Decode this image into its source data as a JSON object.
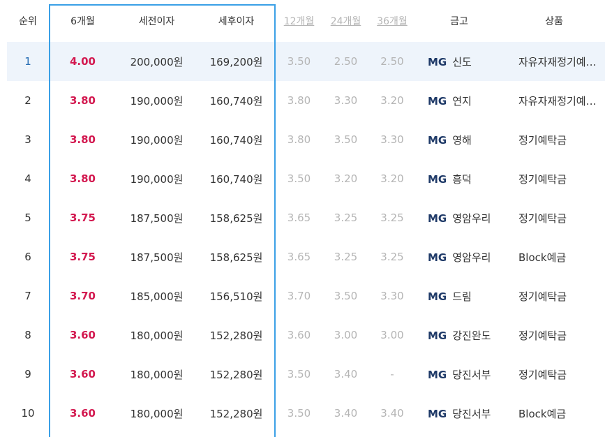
{
  "headers": {
    "rank": "순위",
    "m6": "6개월",
    "pretax": "세전이자",
    "aftertax": "세후이자",
    "m12": "12개월",
    "m24": "24개월",
    "m36": "36개월",
    "bank": "금고",
    "product": "상품"
  },
  "colors": {
    "highlight_border": "#3aa0e6",
    "rate6": "#d31950",
    "muted": "#b5b5b5",
    "first_row_bg": "#eef4fb",
    "mg": "#1f3a68"
  },
  "rows": [
    {
      "rank": "1",
      "m6": "4.00",
      "pretax": "200,000원",
      "aftertax": "169,200원",
      "m12": "3.50",
      "m24": "2.50",
      "m36": "2.50",
      "mg": "MG",
      "bank": "신도",
      "product": "자유자재정기예…"
    },
    {
      "rank": "2",
      "m6": "3.80",
      "pretax": "190,000원",
      "aftertax": "160,740원",
      "m12": "3.80",
      "m24": "3.30",
      "m36": "3.20",
      "mg": "MG",
      "bank": "연지",
      "product": "자유자재정기예…"
    },
    {
      "rank": "3",
      "m6": "3.80",
      "pretax": "190,000원",
      "aftertax": "160,740원",
      "m12": "3.80",
      "m24": "3.50",
      "m36": "3.30",
      "mg": "MG",
      "bank": "영해",
      "product": "정기예탁금"
    },
    {
      "rank": "4",
      "m6": "3.80",
      "pretax": "190,000원",
      "aftertax": "160,740원",
      "m12": "3.50",
      "m24": "3.20",
      "m36": "3.20",
      "mg": "MG",
      "bank": "흥덕",
      "product": "정기예탁금"
    },
    {
      "rank": "5",
      "m6": "3.75",
      "pretax": "187,500원",
      "aftertax": "158,625원",
      "m12": "3.65",
      "m24": "3.25",
      "m36": "3.25",
      "mg": "MG",
      "bank": "영암우리",
      "product": "정기예탁금"
    },
    {
      "rank": "6",
      "m6": "3.75",
      "pretax": "187,500원",
      "aftertax": "158,625원",
      "m12": "3.65",
      "m24": "3.25",
      "m36": "3.25",
      "mg": "MG",
      "bank": "영암우리",
      "product": "Block예금"
    },
    {
      "rank": "7",
      "m6": "3.70",
      "pretax": "185,000원",
      "aftertax": "156,510원",
      "m12": "3.70",
      "m24": "3.50",
      "m36": "3.30",
      "mg": "MG",
      "bank": "드림",
      "product": "정기예탁금"
    },
    {
      "rank": "8",
      "m6": "3.60",
      "pretax": "180,000원",
      "aftertax": "152,280원",
      "m12": "3.60",
      "m24": "3.00",
      "m36": "3.00",
      "mg": "MG",
      "bank": "강진완도",
      "product": "정기예탁금"
    },
    {
      "rank": "9",
      "m6": "3.60",
      "pretax": "180,000원",
      "aftertax": "152,280원",
      "m12": "3.50",
      "m24": "3.40",
      "m36": "-",
      "mg": "MG",
      "bank": "당진서부",
      "product": "정기예탁금"
    },
    {
      "rank": "10",
      "m6": "3.60",
      "pretax": "180,000원",
      "aftertax": "152,280원",
      "m12": "3.50",
      "m24": "3.40",
      "m36": "3.40",
      "mg": "MG",
      "bank": "당진서부",
      "product": "Block예금"
    }
  ]
}
